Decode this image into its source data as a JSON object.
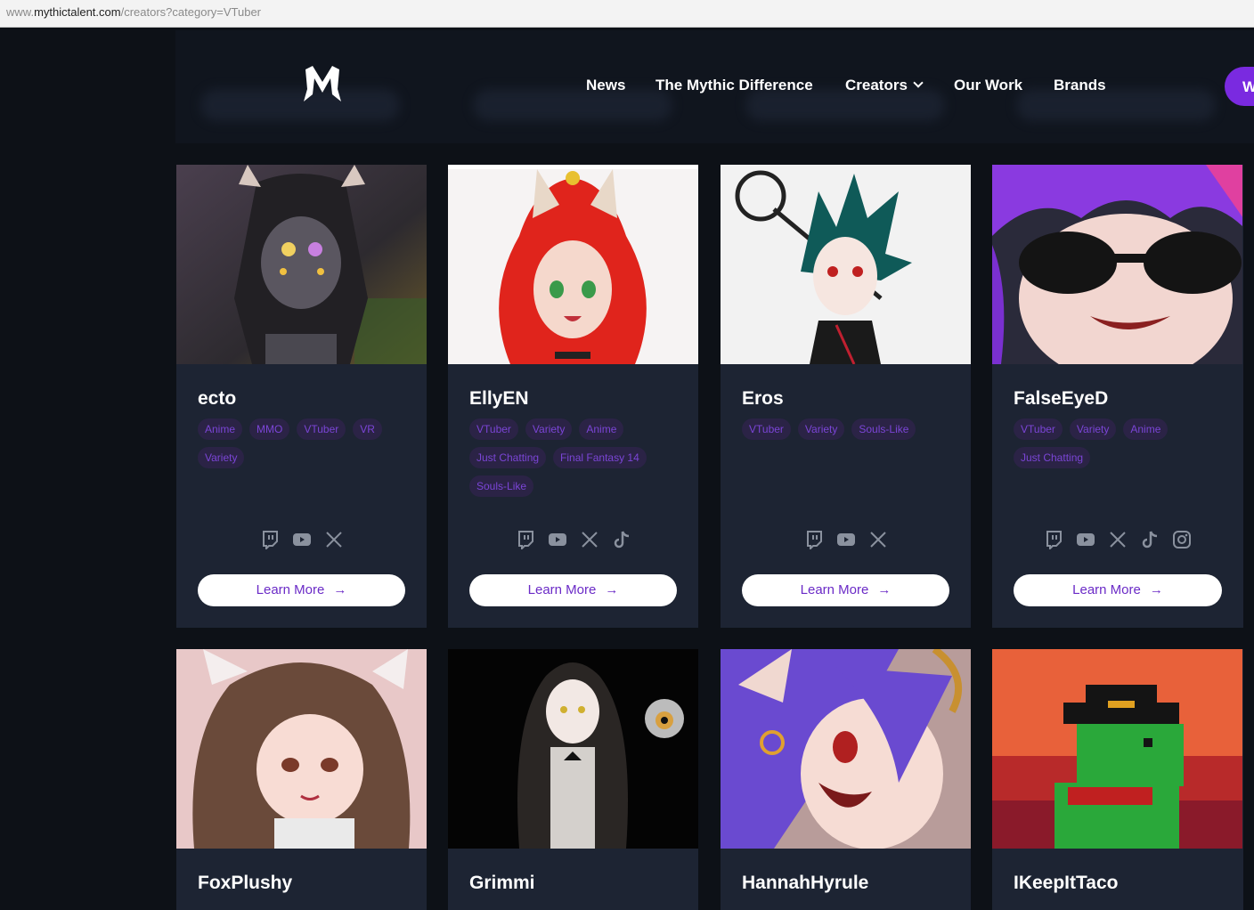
{
  "browser": {
    "url_prefix": "www.",
    "url_host": "mythictalent.com",
    "url_path": "/creators?category=VTuber"
  },
  "nav": {
    "news": "News",
    "mythic_difference": "The Mythic Difference",
    "creators": "Creators",
    "our_work": "Our Work",
    "brands": "Brands",
    "cta": "W"
  },
  "learn_more_label": "Learn More",
  "learn_more_arrow": "→",
  "creators": [
    {
      "name": "ecto",
      "tags": [
        "Anime",
        "MMO",
        "VTuber",
        "VR",
        "Variety"
      ],
      "socials": [
        "twitch-icon",
        "youtube-icon",
        "x-icon"
      ]
    },
    {
      "name": "EllyEN",
      "tags": [
        "VTuber",
        "Variety",
        "Anime",
        "Just Chatting",
        "Final Fantasy 14",
        "Souls-Like"
      ],
      "socials": [
        "twitch-icon",
        "youtube-icon",
        "x-icon",
        "tiktok-icon"
      ]
    },
    {
      "name": "Eros",
      "tags": [
        "VTuber",
        "Variety",
        "Souls-Like"
      ],
      "socials": [
        "twitch-icon",
        "youtube-icon",
        "x-icon"
      ]
    },
    {
      "name": "FalseEyeD",
      "tags": [
        "VTuber",
        "Variety",
        "Anime",
        "Just Chatting"
      ],
      "socials": [
        "twitch-icon",
        "youtube-icon",
        "x-icon",
        "tiktok-icon",
        "instagram-icon"
      ]
    },
    {
      "name": "FoxPlushy",
      "tags": [],
      "socials": []
    },
    {
      "name": "Grimmi",
      "tags": [],
      "socials": []
    },
    {
      "name": "HannahHyrule",
      "tags": [],
      "socials": []
    },
    {
      "name": "IKeepItTaco",
      "tags": [],
      "socials": []
    }
  ],
  "colors": {
    "page_bg": "#0d1117",
    "card_bg": "#1d2433",
    "tag_bg": "#2b2346",
    "tag_text": "#7b45d6",
    "accent": "#7a2ae0"
  }
}
